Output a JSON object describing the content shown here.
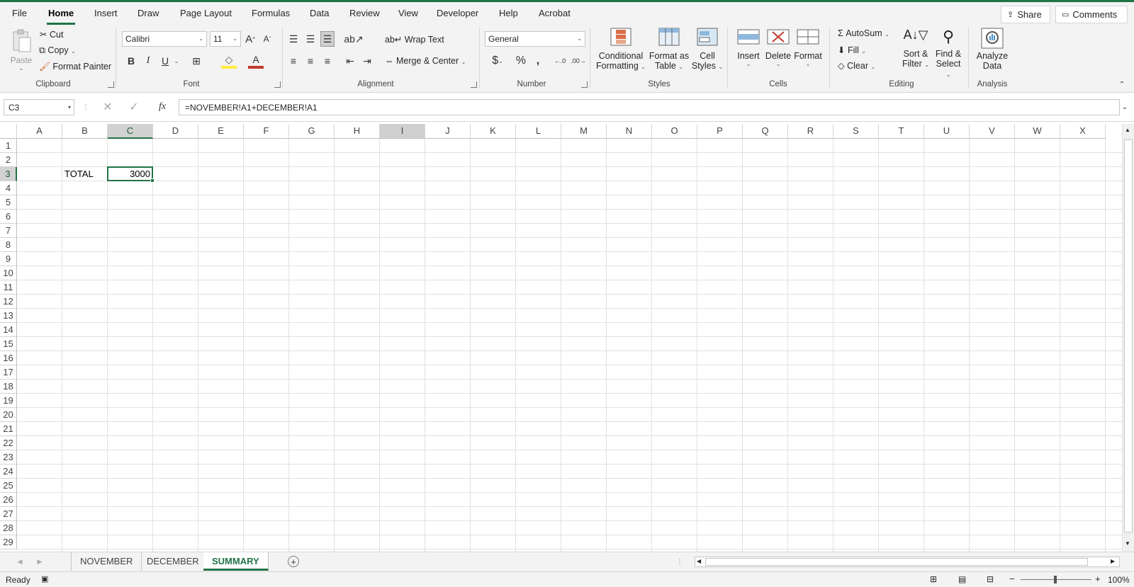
{
  "ribbon_tabs": [
    "File",
    "Home",
    "Insert",
    "Draw",
    "Page Layout",
    "Formulas",
    "Data",
    "Review",
    "View",
    "Developer",
    "Help",
    "Acrobat"
  ],
  "share_label": "Share",
  "comments_label": "Comments",
  "clipboard": {
    "paste": "Paste",
    "cut": "Cut",
    "copy": "Copy",
    "format_painter": "Format Painter",
    "group": "Clipboard"
  },
  "font": {
    "name": "Calibri",
    "size": "11",
    "group": "Font",
    "bold": "B",
    "italic": "I",
    "underline": "U"
  },
  "alignment": {
    "wrap_text": "Wrap Text",
    "merge_center": "Merge & Center",
    "group": "Alignment"
  },
  "number": {
    "format": "General",
    "group": "Number"
  },
  "styles": {
    "conditional": "Conditional",
    "formatting": "Formatting",
    "format_as": "Format as",
    "table": "Table",
    "cell": "Cell",
    "styles": "Styles",
    "group": "Styles"
  },
  "cells": {
    "insert": "Insert",
    "delete": "Delete",
    "format": "Format",
    "group": "Cells"
  },
  "editing": {
    "autosum": "AutoSum",
    "fill": "Fill",
    "clear": "Clear",
    "sort": "Sort &",
    "filter": "Filter",
    "find": "Find &",
    "select": "Select",
    "group": "Editing"
  },
  "analysis": {
    "analyze": "Analyze",
    "data": "Data",
    "group": "Analysis"
  },
  "formula_bar": {
    "name_box": "C3",
    "fx": "fx",
    "formula": "=NOVEMBER!A1+DECEMBER!A1"
  },
  "columns": [
    "A",
    "B",
    "C",
    "D",
    "E",
    "F",
    "G",
    "H",
    "I",
    "J",
    "K",
    "L",
    "M",
    "N",
    "O",
    "P",
    "Q",
    "R",
    "S",
    "T",
    "U",
    "V",
    "W",
    "X"
  ],
  "rows": [
    "1",
    "2",
    "3",
    "4",
    "5",
    "6",
    "7",
    "8",
    "9",
    "10",
    "11",
    "12",
    "13",
    "14",
    "15",
    "16",
    "17",
    "18",
    "19",
    "20",
    "21",
    "22",
    "23",
    "24",
    "25",
    "26",
    "27",
    "28",
    "29"
  ],
  "cells_content": {
    "B3": "TOTAL",
    "C3": "3000"
  },
  "sheets": [
    "NOVEMBER",
    "DECEMBER",
    "SUMMARY"
  ],
  "active_sheet": "SUMMARY",
  "status": {
    "ready": "Ready",
    "zoom": "100%"
  },
  "accent": "#217346"
}
